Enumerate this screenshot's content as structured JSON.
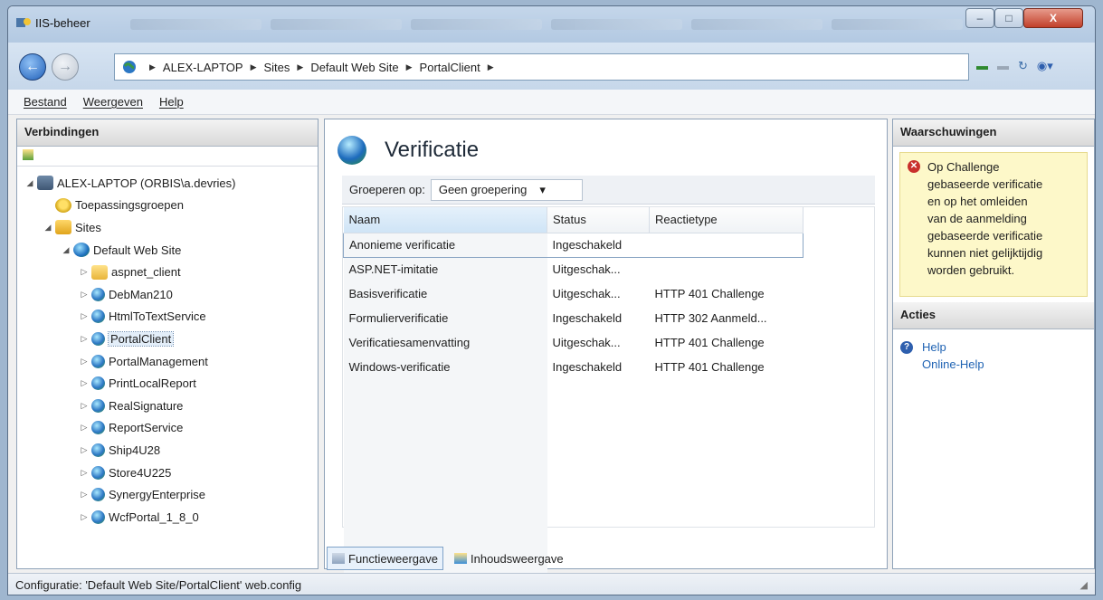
{
  "window": {
    "title": "IIS-beheer",
    "controls": {
      "minimize": "–",
      "maximize": "□",
      "close": "X"
    }
  },
  "address": {
    "segments": [
      "ALEX-LAPTOP",
      "Sites",
      "Default Web Site",
      "PortalClient"
    ],
    "separator": "▶"
  },
  "menu": {
    "items": [
      "Bestand",
      "Weergeven",
      "Help"
    ]
  },
  "connections": {
    "header": "Verbindingen",
    "tree": [
      {
        "label": "ALEX-LAPTOP (ORBIS\\a.devries)",
        "icon": "server-icon",
        "level": 0,
        "twisty": "◢"
      },
      {
        "label": "Toepassingsgroepen",
        "icon": "app-pool-icon",
        "level": 1,
        "twisty": ""
      },
      {
        "label": "Sites",
        "icon": "sites-folder-icon",
        "level": 1,
        "twisty": "◢"
      },
      {
        "label": "Default Web Site",
        "icon": "globe-icon",
        "level": 2,
        "twisty": "◢"
      },
      {
        "label": "aspnet_client",
        "icon": "folder-icon",
        "level": 3,
        "twisty": "▷"
      },
      {
        "label": "DebMan210",
        "icon": "web-app-icon",
        "level": 3,
        "twisty": "▷"
      },
      {
        "label": "HtmlToTextService",
        "icon": "web-app-icon",
        "level": 3,
        "twisty": "▷"
      },
      {
        "label": "PortalClient",
        "icon": "web-app-icon",
        "level": 3,
        "twisty": "▷",
        "selected": true
      },
      {
        "label": "PortalManagement",
        "icon": "web-app-icon",
        "level": 3,
        "twisty": "▷"
      },
      {
        "label": "PrintLocalReport",
        "icon": "web-app-icon",
        "level": 3,
        "twisty": "▷"
      },
      {
        "label": "RealSignature",
        "icon": "web-app-icon",
        "level": 3,
        "twisty": "▷"
      },
      {
        "label": "ReportService",
        "icon": "web-app-icon",
        "level": 3,
        "twisty": "▷"
      },
      {
        "label": "Ship4U28",
        "icon": "web-app-icon",
        "level": 3,
        "twisty": "▷"
      },
      {
        "label": "Store4U225",
        "icon": "web-app-icon",
        "level": 3,
        "twisty": "▷"
      },
      {
        "label": "SynergyEnterprise",
        "icon": "web-app-icon",
        "level": 3,
        "twisty": "▷"
      },
      {
        "label": "WcfPortal_1_8_0",
        "icon": "web-app-icon",
        "level": 3,
        "twisty": "▷"
      }
    ]
  },
  "main": {
    "title": "Verificatie",
    "group_label": "Groeperen op:",
    "group_value": "Geen groepering",
    "group_arrow": "▾",
    "columns": [
      "Naam",
      "Status",
      "Reactietype"
    ],
    "rows": [
      {
        "name": "Anonieme verificatie",
        "status": "Ingeschakeld",
        "reaction": "",
        "selected": true
      },
      {
        "name": "ASP.NET-imitatie",
        "status": "Uitgeschak...",
        "reaction": ""
      },
      {
        "name": "Basisverificatie",
        "status": "Uitgeschak...",
        "reaction": "HTTP 401 Challenge"
      },
      {
        "name": "Formulierverificatie",
        "status": "Ingeschakeld",
        "reaction": "HTTP 302 Aanmeld..."
      },
      {
        "name": "Verificatiesamenvatting",
        "status": "Uitgeschak...",
        "reaction": "HTTP 401 Challenge"
      },
      {
        "name": "Windows-verificatie",
        "status": "Ingeschakeld",
        "reaction": "HTTP 401 Challenge"
      }
    ],
    "view_tabs": [
      "Functieweergave",
      "Inhoudsweergave"
    ]
  },
  "alerts": {
    "header": "Waarschuwingen",
    "message_lines": [
      "Op Challenge",
      "gebaseerde verificatie",
      "en op het omleiden",
      "van de aanmelding",
      "gebaseerde verificatie",
      "kunnen niet gelijktijdig",
      "worden gebruikt."
    ]
  },
  "actions": {
    "header": "Acties",
    "links": [
      "Help",
      "Online-Help"
    ]
  },
  "status_bar": {
    "text": "Configuratie: 'Default Web Site/PortalClient' web.config"
  },
  "colors": {
    "accent": "#1f63b3",
    "warning_bg": "#fdf8c9",
    "error": "#c9302c"
  }
}
